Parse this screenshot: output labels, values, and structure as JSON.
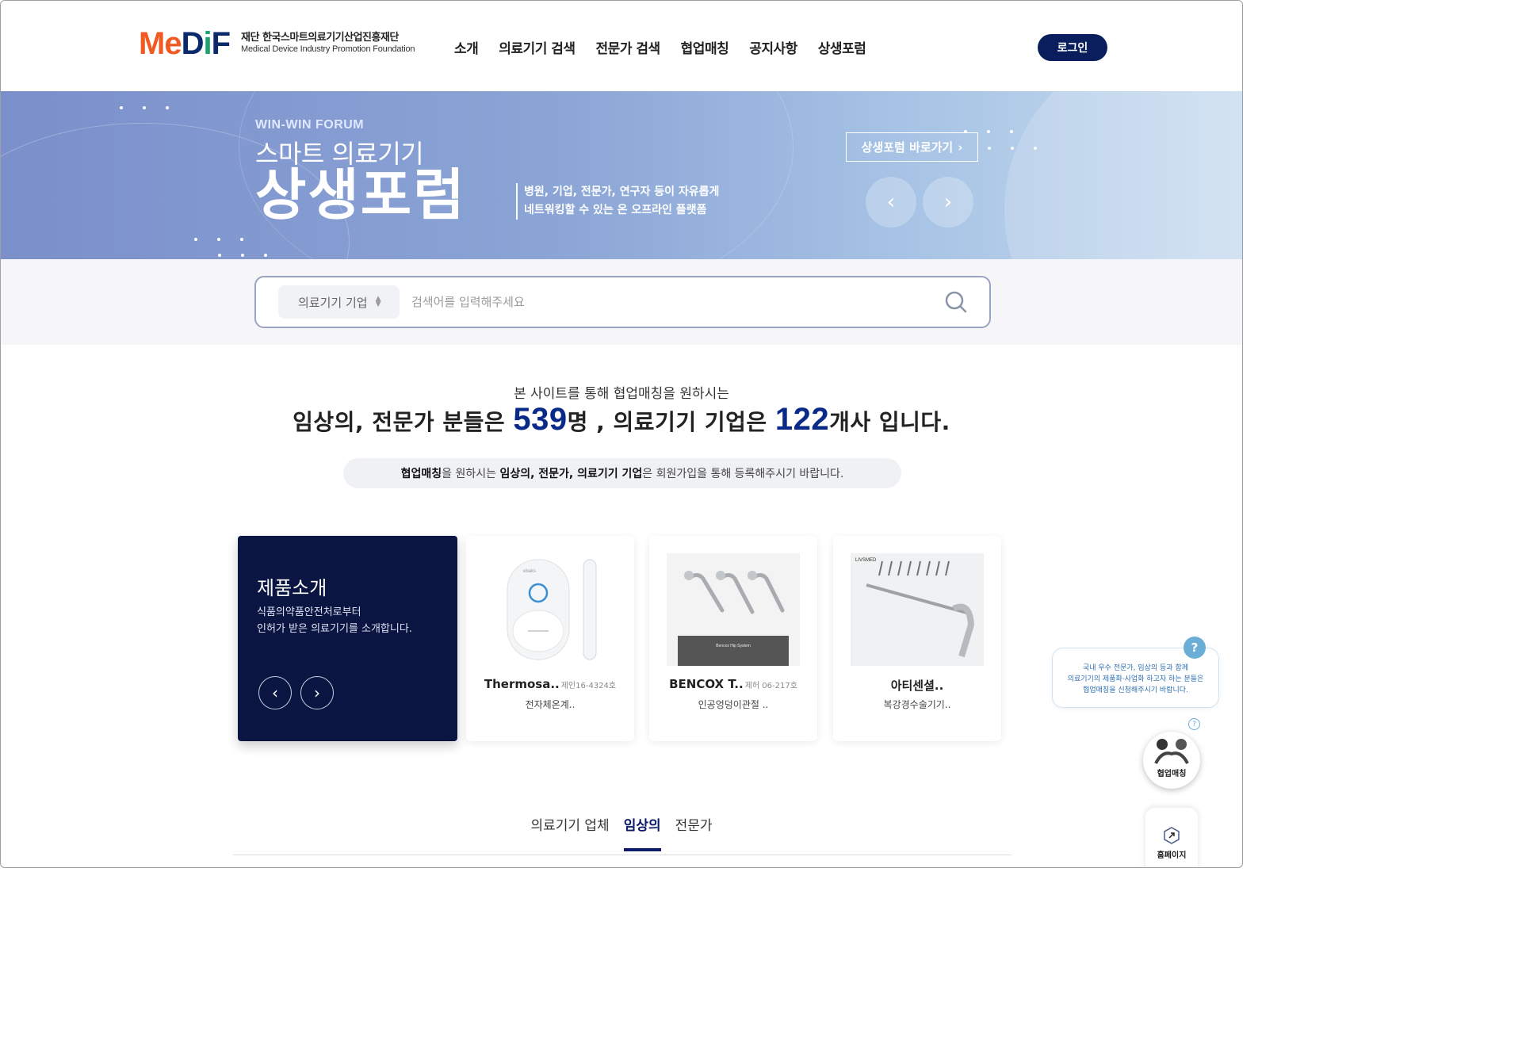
{
  "header": {
    "logo_mark": "MeDiF",
    "logo_ko": "재단 한국스마트의료기기산업진흥재단",
    "logo_en": "Medical Device Industry Promotion Foundation",
    "nav": [
      "소개",
      "의료기기 검색",
      "전문가 검색",
      "협업매칭",
      "공지사항",
      "상생포럼"
    ],
    "login_label": "로그인"
  },
  "hero": {
    "eyebrow": "WIN-WIN FORUM",
    "subtitle": "스마트 의료기기",
    "title": "상생포럼",
    "desc_line1": "병원, 기업, 전문가, 연구자 등이 자유롭게",
    "desc_line2": "네트워킹할 수 있는 온 오프라인 플랫폼",
    "link_label": "상생포럼 바로가기",
    "prev_label": "‹",
    "next_label": "›"
  },
  "search": {
    "category": "의료기기 기업",
    "placeholder": "검색어를 입력해주세요"
  },
  "stats": {
    "line1": "본 사이트를 통해 협업매칭을 원하시는",
    "experts_prefix": "임상의, 전문가 분들은 ",
    "experts_count": "539",
    "experts_suffix": "명 , 의료기기 기업은 ",
    "companies_count": "122",
    "companies_suffix": "개사 입니다.",
    "notice_b1": "협업매칭",
    "notice_t1": "을 원하시는 ",
    "notice_b2": "임상의, 전문가, 의료기기 기업",
    "notice_t2": "은 회원가입을 통해 등록해주시기 바랍니다."
  },
  "intro": {
    "title": "제품소개",
    "desc_line1": "식품의약품안전처로부터",
    "desc_line2": "인허가 받은 의료기기를 소개합니다.",
    "prev": "‹",
    "next": "›"
  },
  "products": [
    {
      "name": "Thermosa..",
      "code": "제인16-4324호",
      "category": "전자체온계.."
    },
    {
      "name": "BENCOX T..",
      "code": "제허 06-217호",
      "category": "인공엉덩이관절 .."
    },
    {
      "name": "아티센셜..",
      "code": "",
      "category": "복강경수술기기.."
    }
  ],
  "tabs": [
    "의료기기 업체",
    "임상의",
    "전문가"
  ],
  "active_tab": "임상의",
  "help": {
    "line1": "국내 우수 전문가, 임상의 등과 함께",
    "line2": "의료기기의 제품화·사업화 하고자 하는 분들은",
    "line3": "협업매칭을 신청해주시기 바랍니다.",
    "q": "?"
  },
  "float": {
    "match_label": "협업매칭",
    "home_label": "홈페이지"
  },
  "colors": {
    "navy": "#0a1d5c",
    "accent_orange": "#f15a22",
    "accent_green": "#1aa36f",
    "hero_start": "#7b8fcb",
    "hero_end": "#c9dcef"
  }
}
